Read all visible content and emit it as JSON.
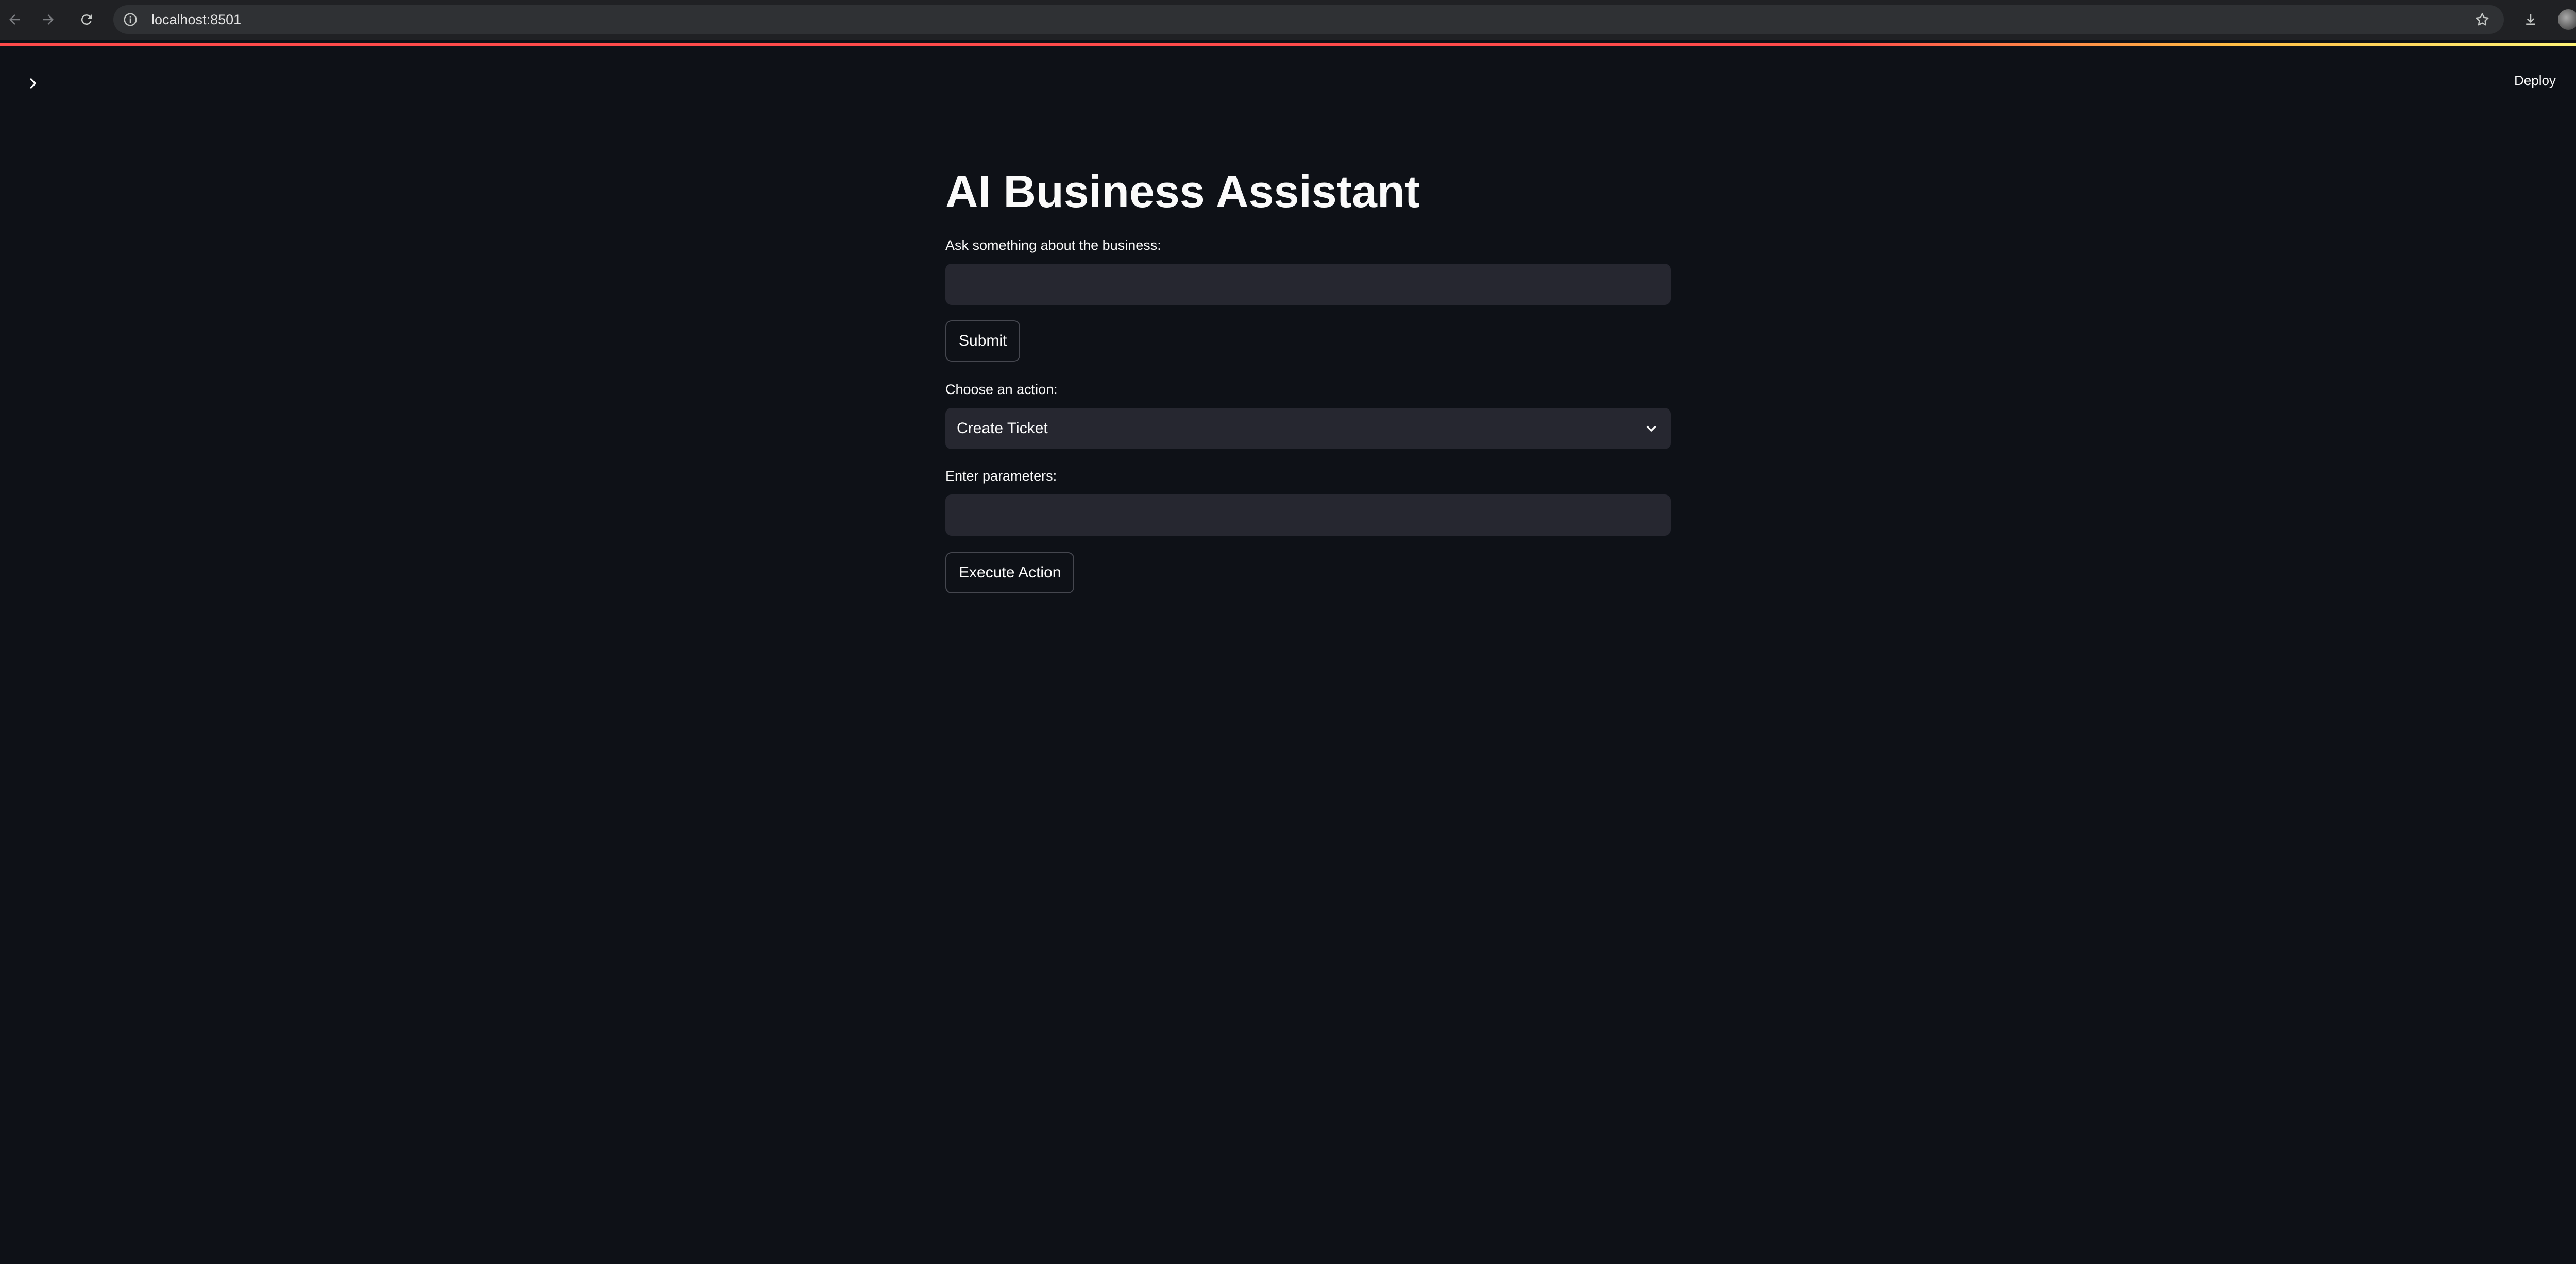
{
  "browser": {
    "url": "localhost:8501",
    "icons": {
      "back": "arrow-left-icon",
      "forward": "arrow-right-icon",
      "reload": "reload-icon",
      "site_info": "info-icon",
      "bookmark": "star-icon",
      "downloads": "download-icon",
      "profile": "avatar",
      "menu": "kebab-menu-icon"
    }
  },
  "app": {
    "header": {
      "deploy_label": "Deploy",
      "sidebar_toggle_icon": "chevron-right-icon",
      "menu_icon": "kebab-menu-icon"
    },
    "title": "AI Business Assistant",
    "question": {
      "label": "Ask something about the business:",
      "value": ""
    },
    "submit_label": "Submit",
    "action": {
      "label": "Choose an action:",
      "selected": "Create Ticket"
    },
    "parameters": {
      "label": "Enter parameters:",
      "value": ""
    },
    "execute_label": "Execute Action"
  },
  "colors": {
    "background": "#0e1117",
    "input_background": "#262730",
    "text": "#fafafa",
    "accent": "#ff4b4b"
  }
}
